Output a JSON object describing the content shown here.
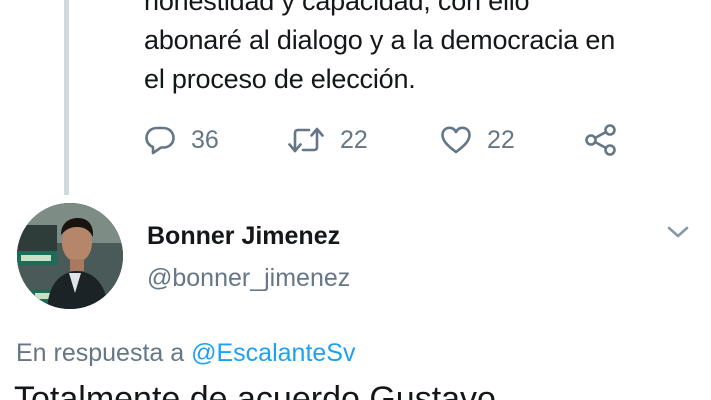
{
  "previous_tweet": {
    "lines": [
      "honestidad y capacidad, con ello",
      "abonaré al dialogo y a la democracia en",
      "el proceso de elección."
    ],
    "actions": {
      "reply_count": "36",
      "retweet_count": "22",
      "like_count": "22"
    }
  },
  "tweet": {
    "author_name": "Bonner Jimenez",
    "author_handle": "@bonner_jimenez",
    "reply_prefix": "En respuesta a",
    "reply_mention": "@EscalanteSv",
    "text_partial": "Totalmente de acuerdo Gustavo"
  },
  "icons": {
    "reply": "reply-icon",
    "retweet": "retweet-icon",
    "like": "heart-icon",
    "share": "share-icon",
    "menu": "chevron-down-icon"
  },
  "colors": {
    "text": "#14171a",
    "muted": "#657786",
    "link": "#1da1f2",
    "thread_line": "#cfd9de"
  }
}
